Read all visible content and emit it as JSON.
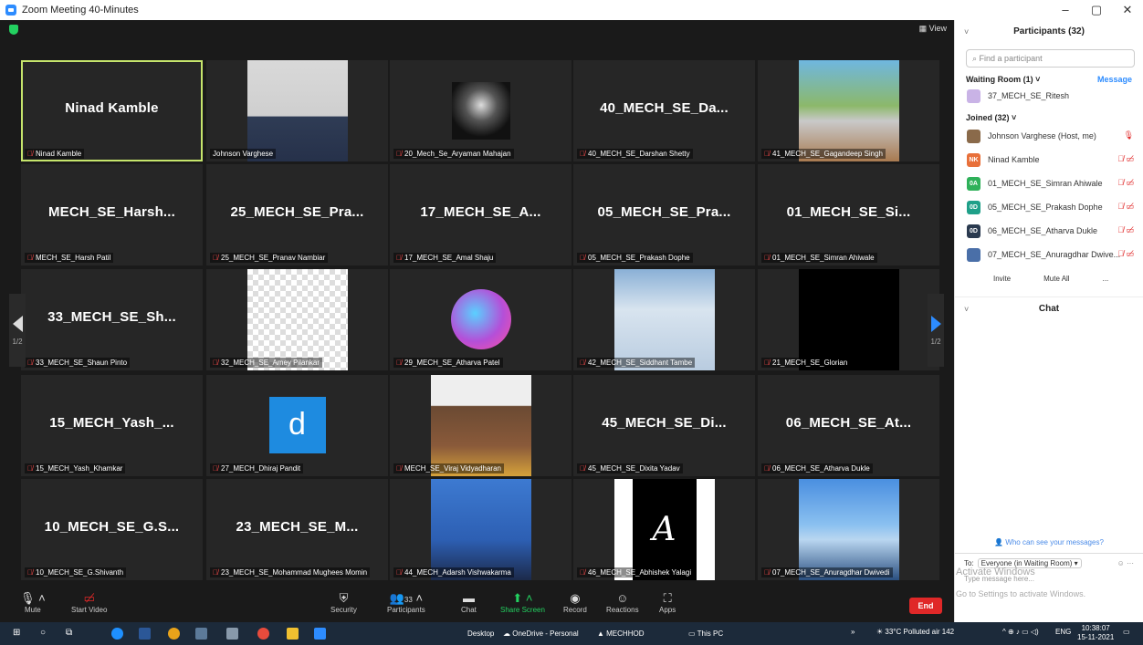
{
  "window": {
    "title": "Zoom Meeting 40-Minutes",
    "minimize": "–",
    "maximize": "▢",
    "close": "✕"
  },
  "view_label": "▦ View",
  "page_indicator_left": "1/2",
  "page_indicator_right": "1/2",
  "tiles": [
    {
      "display": "Ninad Kamble",
      "label": "Ninad Kamble",
      "muted": true,
      "active": true
    },
    {
      "display": "",
      "label": "Johnson Varghese",
      "muted": false,
      "photo": "portrait"
    },
    {
      "display": "",
      "label": "20_Mech_Se_Aryaman Mahajan",
      "muted": true,
      "photo": "dark-art"
    },
    {
      "display": "40_MECH_SE_Da...",
      "label": "40_MECH_SE_Darshan Shetty",
      "muted": true
    },
    {
      "display": "",
      "label": "41_MECH_SE_Gagandeep Singh",
      "muted": true,
      "photo": "outdoor"
    },
    {
      "display": "MECH_SE_Harsh...",
      "label": "MECH_SE_Harsh Patil",
      "muted": true
    },
    {
      "display": "25_MECH_SE_Pra...",
      "label": "25_MECH_SE_Pranav Nambiar",
      "muted": true
    },
    {
      "display": "17_MECH_SE_A...",
      "label": "17_MECH_SE_Amal Shaju",
      "muted": true
    },
    {
      "display": "05_MECH_SE_Pra...",
      "label": "05_MECH_SE_Prakash Dophe",
      "muted": true
    },
    {
      "display": "01_MECH_SE_Si...",
      "label": "01_MECH_SE_Simran Ahiwale",
      "muted": true
    },
    {
      "display": "33_MECH_SE_Sh...",
      "label": "33_MECH_SE_Shaun Pinto",
      "muted": true
    },
    {
      "display": "",
      "label": "32_MECH_SE_Amey Pilankar",
      "muted": true,
      "photo": "anime"
    },
    {
      "display": "",
      "label": "29_MECH_SE_Atharva Patel",
      "muted": true,
      "photo": "palm"
    },
    {
      "display": "",
      "label": "42_MECH_SE_Siddhant Tambe",
      "muted": true,
      "photo": "idcard"
    },
    {
      "display": "",
      "label": "21_MECH_SE_Glorian",
      "muted": true,
      "photo": "black"
    },
    {
      "display": "15_MECH_Yash_...",
      "label": "15_MECH_Yash_Khamkar",
      "muted": true
    },
    {
      "display": "",
      "label": "27_MECH_Dhiraj Pandit",
      "muted": true,
      "photo": "letter-d"
    },
    {
      "display": "",
      "label": "MECH_SE_Viraj Vidyadharan",
      "muted": true,
      "photo": "face-light"
    },
    {
      "display": "45_MECH_SE_Di...",
      "label": "45_MECH_SE_Dixita Yadav",
      "muted": true
    },
    {
      "display": "06_MECH_SE_At...",
      "label": "06_MECH_SE_Atharva Dukle",
      "muted": true
    },
    {
      "display": "10_MECH_SE_G.S...",
      "label": "10_MECH_SE_G.Shivanth",
      "muted": true
    },
    {
      "display": "23_MECH_SE_M...",
      "label": "23_MECH_SE_Mohammad Mughees Momin",
      "muted": true
    },
    {
      "display": "",
      "label": "44_MECH_Adarsh Vishwakarma",
      "muted": true,
      "photo": "face-blue"
    },
    {
      "display": "",
      "label": "46_MECH_SE_Abhishek Yalagi",
      "muted": true,
      "photo": "letter-a"
    },
    {
      "display": "",
      "label": "07_MECH_SE_Anuragdhar Dwivedi",
      "muted": true,
      "photo": "sky"
    }
  ],
  "toolbar": {
    "mute": "Mute",
    "start_video": "Start Video",
    "security": "Security",
    "participants": "Participants",
    "participants_count": "33",
    "chat": "Chat",
    "share_screen": "Share Screen",
    "record": "Record",
    "reactions": "Reactions",
    "apps": "Apps",
    "end": "End"
  },
  "panel": {
    "title": "Participants (32)",
    "search_placeholder": "Find a participant",
    "waiting_room": "Waiting Room (1)",
    "message": "Message",
    "waiting": [
      {
        "name": "37_MECH_SE_Ritesh",
        "avatar": "",
        "color": "#c9b3e6"
      }
    ],
    "joined": "Joined (32)",
    "participants": [
      {
        "name": "Johnson Varghese (Host, me)",
        "avatar": "",
        "color": "#8a6a4a",
        "icons": "🎙"
      },
      {
        "name": "Ninad Kamble",
        "avatar": "NK",
        "color": "#e8703a",
        "icons": "🎙̸ ▭̸"
      },
      {
        "name": "01_MECH_SE_Simran Ahiwale",
        "avatar": "0A",
        "color": "#2fb15a",
        "icons": "🎙̸ ▭̸"
      },
      {
        "name": "05_MECH_SE_Prakash Dophe",
        "avatar": "0D",
        "color": "#1fa089",
        "icons": "🎙̸ ▭̸"
      },
      {
        "name": "06_MECH_SE_Atharva Dukle",
        "avatar": "0D",
        "color": "#2a3a4f",
        "icons": "🎙̸ ▭̸"
      },
      {
        "name": "07_MECH_SE_Anuragdhar Dwive...",
        "avatar": "",
        "color": "#4a6fa8",
        "icons": "🎙̸ ▭̸"
      }
    ],
    "invite": "Invite",
    "mute_all": "Mute All",
    "more": "...",
    "chat_title": "Chat",
    "who_can_see": "Who can see your messages?",
    "to_label": "To:",
    "to_value": "Everyone (in Waiting Room) ▾",
    "placeholder": "Type message here...",
    "activate_title": "Activate Windows",
    "activate_sub": "Go to Settings to activate Windows."
  },
  "taskbar": {
    "desktop": "Desktop",
    "onedrive": "OneDrive - Personal",
    "mechhod": "MECHHOD",
    "thispc": "This PC",
    "weather": "33°C  Polluted air 142",
    "lang": "ENG",
    "time": "10:38:07",
    "date": "15-11-2021"
  }
}
